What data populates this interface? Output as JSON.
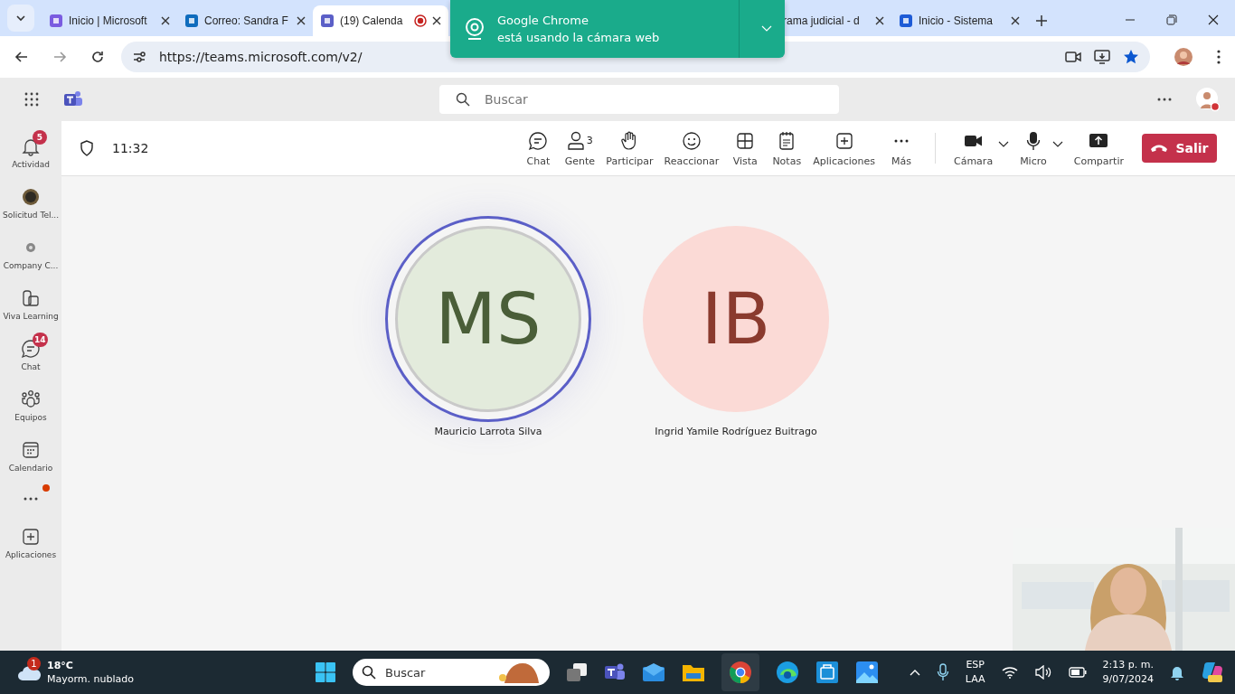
{
  "browser": {
    "tabs": [
      {
        "title": "Inicio | Microsoft",
        "selected": false,
        "recording": false
      },
      {
        "title": "Correo: Sandra F",
        "selected": false,
        "recording": false
      },
      {
        "title": "(19) Calenda",
        "selected": true,
        "recording": true
      },
      {
        "title": "rama judicial - d",
        "selected": false,
        "recording": false
      },
      {
        "title": "Inicio - Sistema",
        "selected": false,
        "recording": false
      }
    ],
    "url": "https://teams.microsoft.com/v2/",
    "notification": {
      "line_1": "Google Chrome",
      "line_2": "está usando la cámara web"
    }
  },
  "teams": {
    "search": {
      "placeholder": "Buscar"
    },
    "sidebar": [
      {
        "label": "Actividad",
        "badge": "5",
        "dot": false
      },
      {
        "label": "Solicitud Tel...",
        "dot": false
      },
      {
        "label": "Company C...",
        "dot": false
      },
      {
        "label": "Viva Learning",
        "dot": false
      },
      {
        "label": "Chat",
        "badge": "14",
        "dot": false
      },
      {
        "label": "Equipos",
        "dot": false
      },
      {
        "label": "Calendario",
        "dot": false
      },
      {
        "dot": true
      },
      {
        "label": "Aplicaciones",
        "dot": false
      }
    ],
    "meeting": {
      "time": "11:32",
      "tools": [
        {
          "label": "Chat"
        },
        {
          "label": "Gente",
          "count": "3"
        },
        {
          "label": "Participar"
        },
        {
          "label": "Reaccionar"
        },
        {
          "label": "Vista"
        },
        {
          "label": "Notas"
        },
        {
          "label": "Aplicaciones"
        },
        {
          "label": "Más"
        }
      ],
      "devices": [
        {
          "label": "Cámara"
        },
        {
          "label": "Micro"
        }
      ],
      "share": "Compartir",
      "leave": "Salir",
      "participants": [
        {
          "initials": "MS",
          "name": "Mauricio Larrota Silva",
          "speaking": true,
          "color": "#e3ebdc"
        },
        {
          "initials": "IB",
          "name": "Ingrid Yamile Rodríguez Buitrago",
          "speaking": false,
          "color": "#fbdad6"
        }
      ]
    }
  },
  "taskbar": {
    "weather": {
      "badge": "1",
      "temp": "18°C",
      "text": "Mayorm. nublado"
    },
    "search": "Buscar",
    "lang": "ESP",
    "layout": "LAA",
    "time": "2:13 p. m.",
    "date": "9/07/2024"
  }
}
